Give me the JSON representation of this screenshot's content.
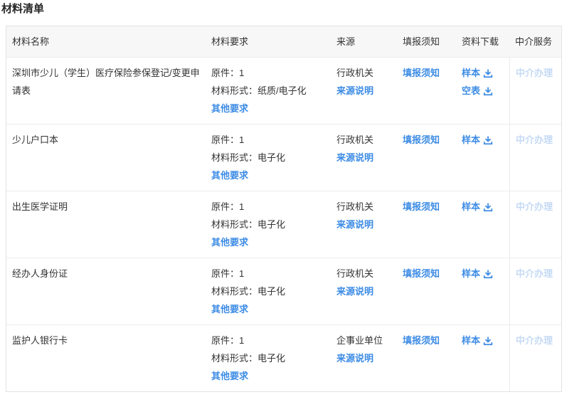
{
  "page": {
    "title": "材料清单"
  },
  "colors": {
    "link_blue": "#3d8ce5",
    "disabled_link_blue": "#c5daf5",
    "header_bg": "#f7f7f7",
    "border": "#e3e3e3",
    "text": "#333333"
  },
  "table": {
    "headers": [
      "材料名称",
      "材料要求",
      "来源",
      "填报须知",
      "资料下载",
      "中介服务"
    ],
    "rows": [
      {
        "name": "深圳市少儿（学生）医疗保险参保登记/变更申请表",
        "original": "原件：1",
        "form": "材料形式：纸质/电子化",
        "other_link": "其他要求",
        "source": "行政机关",
        "source_link": "来源说明",
        "notice_link": "填报须知",
        "downloads": [
          {
            "label": "样本"
          },
          {
            "label": "空表"
          }
        ],
        "agency_link": "中介办理",
        "agency_disabled": true
      },
      {
        "name": "少儿户口本",
        "original": "原件：1",
        "form": "材料形式：电子化",
        "other_link": "其他要求",
        "source": "行政机关",
        "source_link": "来源说明",
        "notice_link": "填报须知",
        "downloads": [
          {
            "label": "样本"
          }
        ],
        "agency_link": "中介办理",
        "agency_disabled": true
      },
      {
        "name": "出生医学证明",
        "original": "原件：1",
        "form": "材料形式：电子化",
        "other_link": "其他要求",
        "source": "行政机关",
        "source_link": "来源说明",
        "notice_link": "填报须知",
        "downloads": [
          {
            "label": "样本"
          }
        ],
        "agency_link": "中介办理",
        "agency_disabled": true
      },
      {
        "name": "经办人身份证",
        "original": "原件：1",
        "form": "材料形式：电子化",
        "other_link": "其他要求",
        "source": "行政机关",
        "source_link": "来源说明",
        "notice_link": "填报须知",
        "downloads": [
          {
            "label": "样本"
          }
        ],
        "agency_link": "中介办理",
        "agency_disabled": true
      },
      {
        "name": "监护人银行卡",
        "original": "原件：1",
        "form": "材料形式：电子化",
        "other_link": "其他要求",
        "source": "企事业单位",
        "source_link": "来源说明",
        "notice_link": "填报须知",
        "downloads": [
          {
            "label": "样本"
          }
        ],
        "agency_link": "中介办理",
        "agency_disabled": true
      }
    ]
  }
}
